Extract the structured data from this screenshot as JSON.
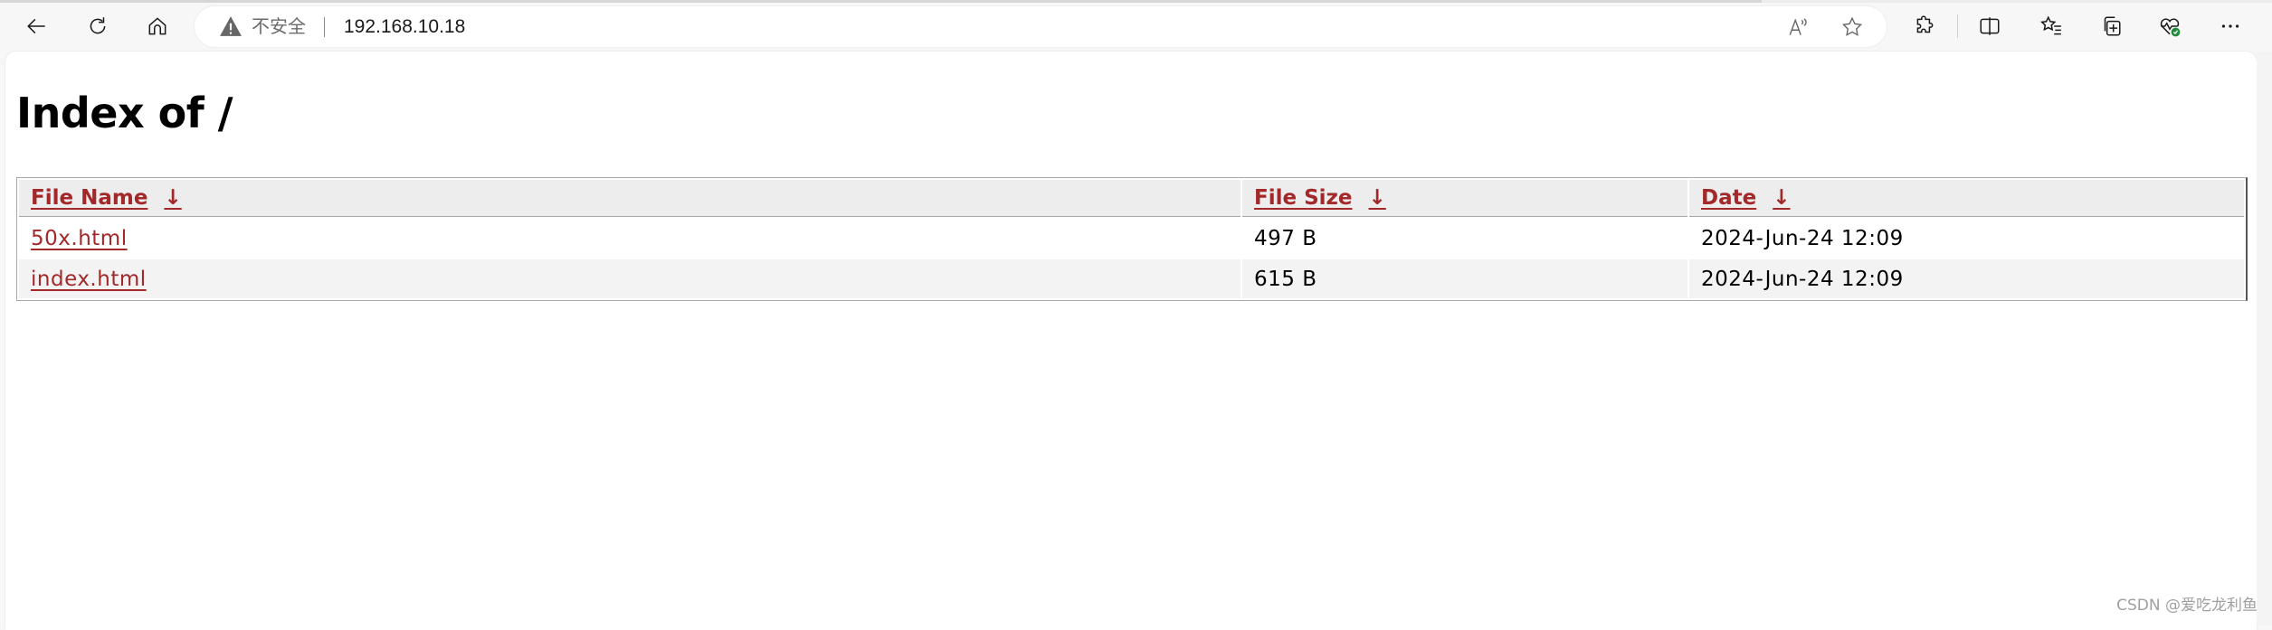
{
  "browser": {
    "nav": {
      "back_icon": "arrow-left-icon",
      "refresh_icon": "refresh-icon",
      "home_icon": "home-icon"
    },
    "address_bar": {
      "security_icon": "warning-triangle-icon",
      "security_label": "不安全",
      "url": "192.168.10.18",
      "read_aloud_icon": "read-aloud-icon",
      "favorite_icon": "star-icon"
    },
    "toolbar_icons": [
      "extensions-icon",
      "split-screen-icon",
      "favorites-icon",
      "collections-icon",
      "browser-essentials-icon",
      "more-icon"
    ]
  },
  "page": {
    "title": "Index of /",
    "table": {
      "columns": [
        {
          "label": "File Name",
          "sort_indicator": "↓"
        },
        {
          "label": "File Size",
          "sort_indicator": "↓"
        },
        {
          "label": "Date",
          "sort_indicator": "↓"
        }
      ],
      "rows": [
        {
          "name": "50x.html",
          "size": "497 B",
          "date": "2024-Jun-24 12:09"
        },
        {
          "name": "index.html",
          "size": "615 B",
          "date": "2024-Jun-24 12:09"
        }
      ]
    }
  },
  "colors": {
    "link": "#a3282a",
    "header_bg": "#ededed",
    "row_alt_bg": "#f3f3f3",
    "essentials_badge": "#1f8b3b"
  },
  "watermark": "CSDN @爱吃龙利鱼"
}
